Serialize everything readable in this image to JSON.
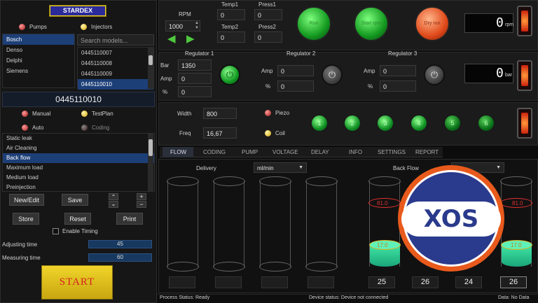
{
  "brand": {
    "logo": "STARDEX"
  },
  "left": {
    "radio_pumps": "Pumps",
    "radio_injectors": "Injectors",
    "manufacturers": [
      "Bosch",
      "Denso",
      "Delphi",
      "Siemens"
    ],
    "search_placeholder": "Search models...",
    "models": [
      "0445110007",
      "0445110008",
      "0445110009",
      "0445110010"
    ],
    "selected_model": "0445110010",
    "mode_manual": "Manual",
    "mode_testplan": "TestPlan",
    "mode_auto": "Auto",
    "mode_coding": "Coding",
    "tests": [
      "Static leak",
      "Air Cleaning",
      "Back flow",
      "Maximum load",
      "Medium load",
      "Preinjection"
    ],
    "btn_newedit": "New/Edit",
    "btn_save": "Save",
    "btn_up": "⌃",
    "btn_down": "⌄",
    "btn_plus": "+",
    "btn_minus": "−",
    "btn_store": "Store",
    "btn_reset": "Reset",
    "btn_print": "Print",
    "enable_timing": "Enable Timing",
    "adjusting_label": "Adjusting time",
    "adjusting_value": "45",
    "measuring_label": "Measuring time",
    "measuring_value": "60",
    "start": "START"
  },
  "top": {
    "rpm_label": "RPM",
    "rpm_value": "1000",
    "temp1_label": "Temp1",
    "temp1_value": "0",
    "press1_label": "Press1",
    "press1_value": "0",
    "temp2_label": "Temp2",
    "temp2_value": "0",
    "press2_label": "Press2",
    "press2_value": "0",
    "btn_green1": "Run",
    "btn_green2": "Start rpm",
    "btn_orange": "Dry run",
    "rpm_display": "0",
    "rpm_unit": "rpm",
    "bar_display": "0",
    "bar_unit": "bar"
  },
  "regulators": {
    "r1_title": "Regulator 1",
    "r2_title": "Regulator 2",
    "r3_title": "Regulator 3",
    "bar_label": "Bar",
    "bar_value": "1350",
    "amp_label": "Amp",
    "pct_label": "%",
    "r1_amp": "0",
    "r1_pct": "0",
    "r2_amp": "0",
    "r2_pct": "0",
    "r3_amp": "0",
    "r3_pct": "0"
  },
  "pulse": {
    "width_label": "Width",
    "width_value": "800",
    "freq_label": "Freq",
    "freq_value": "16,67",
    "piezo": "Piezo",
    "coil": "Coil",
    "channels": [
      "1",
      "2",
      "3",
      "4",
      "5",
      "6"
    ]
  },
  "tabs": [
    "FLOW",
    "CODING",
    "PUMP",
    "VOLTAGE",
    "DELAY",
    "INFO",
    "SETTINGS",
    "REPORT"
  ],
  "flow": {
    "delivery_label": "Delivery",
    "delivery_unit": "ml/min",
    "backflow_label": "Back Flow",
    "backflow_max": [
      "81.0",
      "81.0"
    ],
    "backflow_fill": [
      "17.0",
      "17.0"
    ],
    "backflow_values": [
      "25",
      "26",
      "24",
      "26"
    ]
  },
  "status": {
    "process": "Process Status: Ready",
    "device": "Device status: Device not connected",
    "data": "Data: No Data"
  },
  "watermark": "XOS",
  "colors": {
    "accent_blue": "#1d3f78",
    "led_green": "#22c13a",
    "start_yellow": "#e2c11a",
    "danger_red": "#d83030"
  }
}
